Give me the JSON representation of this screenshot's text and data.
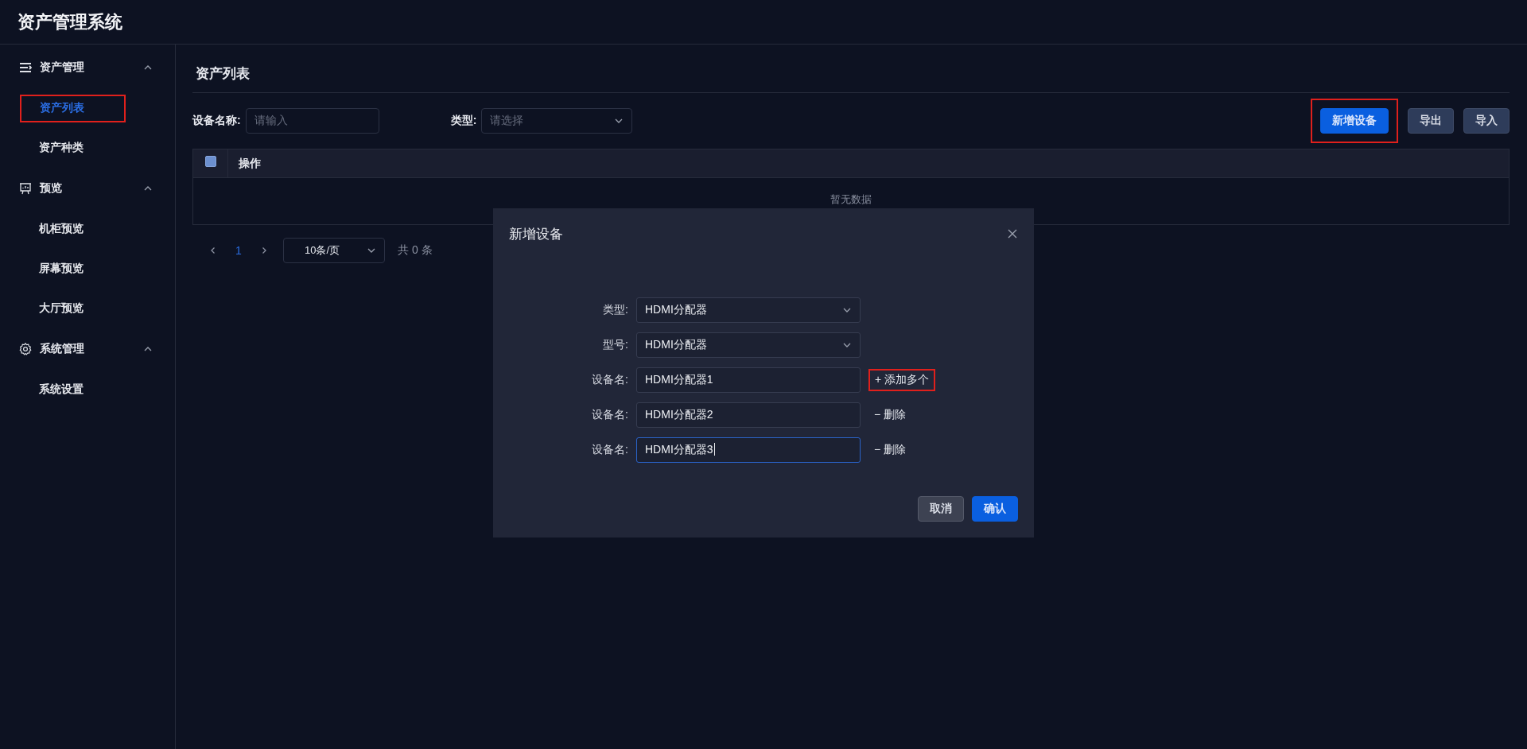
{
  "app": {
    "title": "资产管理系统"
  },
  "sidebar": {
    "groups": [
      {
        "label": "资产管理",
        "expanded": true,
        "items": [
          {
            "label": "资产列表",
            "selected": true,
            "highlighted": true
          },
          {
            "label": "资产种类",
            "selected": false,
            "highlighted": false
          }
        ]
      },
      {
        "label": "预览",
        "expanded": true,
        "items": [
          {
            "label": "机柜预览",
            "selected": false,
            "highlighted": false
          },
          {
            "label": "屏幕预览",
            "selected": false,
            "highlighted": false
          },
          {
            "label": "大厅预览",
            "selected": false,
            "highlighted": false
          }
        ]
      },
      {
        "label": "系统管理",
        "expanded": true,
        "items": [
          {
            "label": "系统设置",
            "selected": false,
            "highlighted": false
          }
        ]
      }
    ]
  },
  "page": {
    "title": "资产列表"
  },
  "filters": [
    {
      "kind": "input",
      "label": "设备名称:",
      "placeholder": "请输入"
    },
    {
      "kind": "select",
      "label": "类型:",
      "placeholder": "请选择"
    }
  ],
  "actions": [
    {
      "label": "新增设备",
      "primary": true,
      "highlighted": true
    },
    {
      "label": "导出",
      "primary": false,
      "highlighted": false
    },
    {
      "label": "导入",
      "primary": false,
      "highlighted": false
    }
  ],
  "table": {
    "header_checkbox": {
      "checked": false
    },
    "columns": [
      "操作"
    ],
    "empty_text": "暂无数据"
  },
  "pagination": {
    "current": "1",
    "page_size": "10条/页",
    "total": "共 0 条"
  },
  "dialog": {
    "title": "新增设备",
    "fields": [
      {
        "kind": "select",
        "label": "类型:",
        "value": "HDMI分配器",
        "focused": false
      },
      {
        "kind": "select",
        "label": "型号:",
        "value": "HDMI分配器",
        "focused": false
      },
      {
        "kind": "input",
        "label": "设备名:",
        "value": "HDMI分配器1",
        "focused": false,
        "action": {
          "label": "+ 添加多个",
          "highlighted": true
        }
      },
      {
        "kind": "input",
        "label": "设备名:",
        "value": "HDMI分配器2",
        "focused": false,
        "action": {
          "label": "− 删除",
          "highlighted": false
        }
      },
      {
        "kind": "input",
        "label": "设备名:",
        "value": "HDMI分配器3",
        "focused": true,
        "action": {
          "label": "− 删除",
          "highlighted": false
        }
      }
    ],
    "buttons": [
      {
        "label": "取消",
        "primary": false
      },
      {
        "label": "确认",
        "primary": true
      }
    ]
  }
}
